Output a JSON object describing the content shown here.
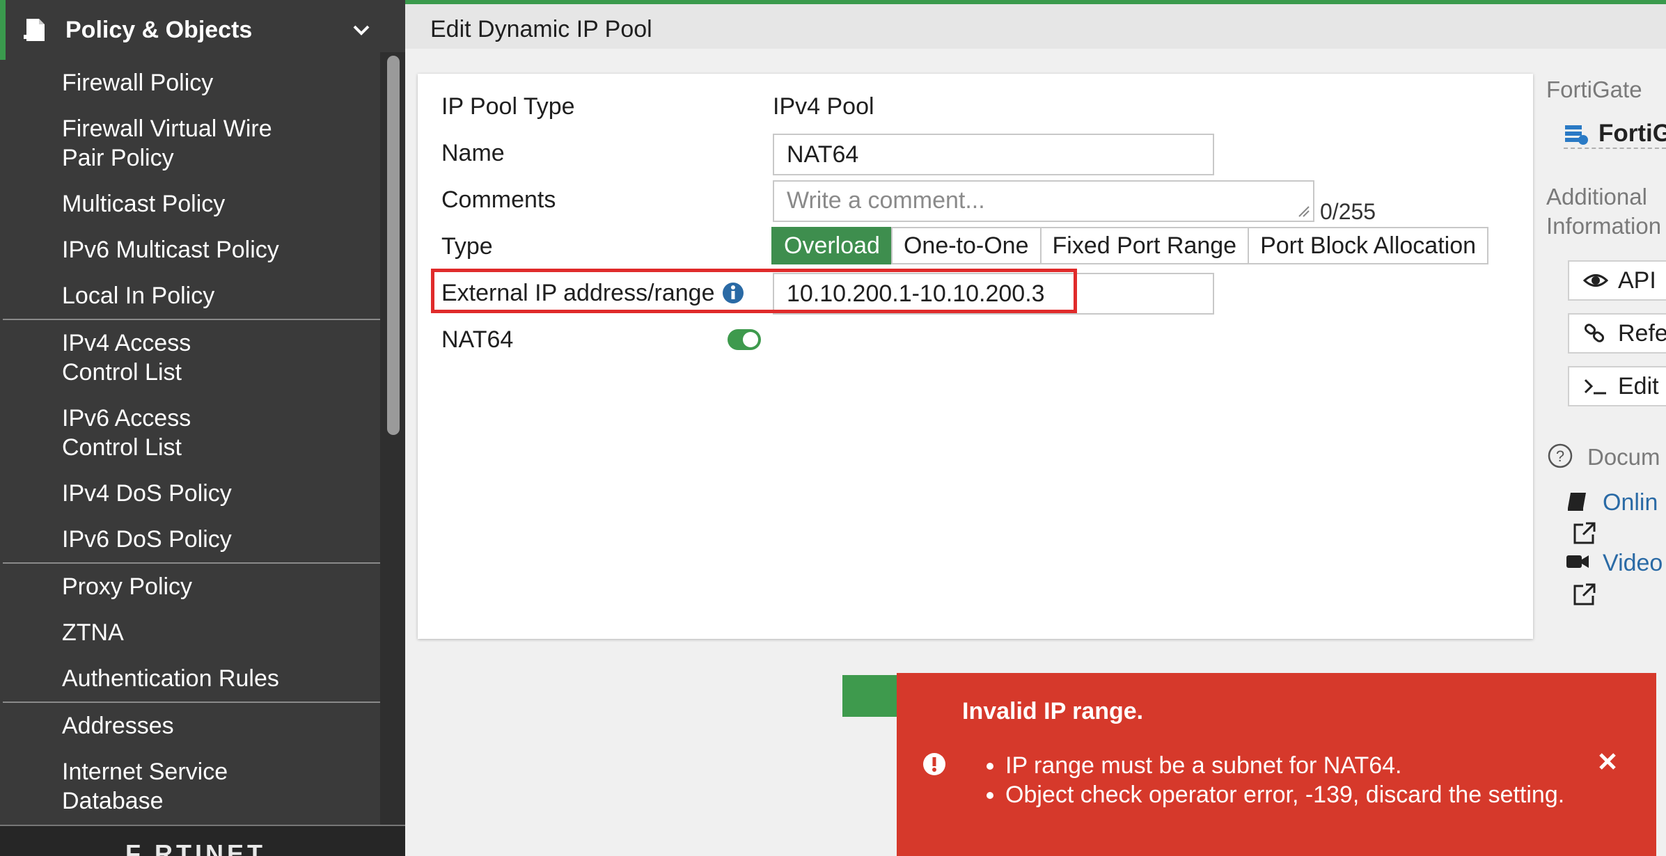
{
  "sidebar": {
    "section_title": "Policy & Objects",
    "items": [
      {
        "label": "Firewall Policy"
      },
      {
        "label": "Firewall Virtual Wire Pair Policy"
      },
      {
        "label": "Multicast Policy"
      },
      {
        "label": "IPv6 Multicast Policy"
      },
      {
        "label": "Local In Policy"
      },
      {
        "label": "IPv4 Access Control List"
      },
      {
        "label": "IPv6 Access Control List"
      },
      {
        "label": "IPv4 DoS Policy"
      },
      {
        "label": "IPv6 DoS Policy"
      },
      {
        "label": "Proxy Policy"
      },
      {
        "label": "ZTNA"
      },
      {
        "label": "Authentication Rules"
      },
      {
        "label": "Addresses"
      },
      {
        "label": "Internet Service Database"
      }
    ],
    "footer_logo": "F RTINET"
  },
  "page": {
    "title": "Edit Dynamic IP Pool"
  },
  "form": {
    "ip_pool_type_label": "IP Pool Type",
    "ip_pool_type_value": "IPv4 Pool",
    "name_label": "Name",
    "name_value": "NAT64",
    "comments_label": "Comments",
    "comments_placeholder": "Write a comment...",
    "comments_counter": "0/255",
    "type_label": "Type",
    "type_options": [
      "Overload",
      "One-to-One",
      "Fixed Port Range",
      "Port Block Allocation"
    ],
    "type_selected": "Overload",
    "external_ip_label": "External IP address/range",
    "external_ip_value": "10.10.200.1-10.10.200.3",
    "nat64_label": "NAT64",
    "nat64_enabled": true
  },
  "right_panel": {
    "fortigate_label": "FortiGate",
    "fortigate_name": "FortiG",
    "additional_info_line1": "Additional",
    "additional_info_line2": "Information",
    "api_button": "API",
    "references_button": "Refe",
    "edit_cli_button": "Edit",
    "documentation_label": "Docum",
    "online_help_link": "Onlin",
    "video_link": "Video"
  },
  "toast": {
    "title": "Invalid IP range.",
    "messages": [
      "IP range must be a subnet for NAT64.",
      "Object check operator error, -139, discard the setting."
    ],
    "color": "#d6392b"
  },
  "colors": {
    "accent_green": "#3e8e4e",
    "sidebar_bg": "#3a3a3a",
    "highlight_red": "#e02b2b",
    "link_blue": "#2a6aa5"
  }
}
